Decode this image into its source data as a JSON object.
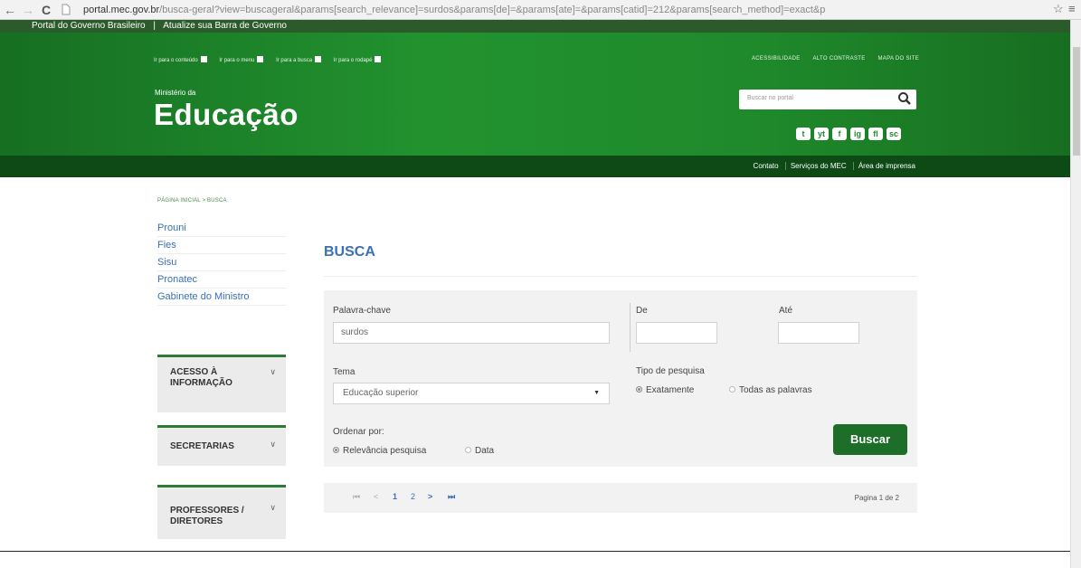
{
  "browser": {
    "back": "←",
    "forward": "→",
    "reload": "C",
    "url_host": "portal.mec.gov.br",
    "url_path": "/busca-geral?view=buscageral&params[search_relevance]=surdos&params[de]=&params[ate]=&params[catid]=212&params[search_method]=exact&p",
    "star": "☆",
    "menu": "≡"
  },
  "govbar": {
    "portal": "Portal do Governo Brasileiro",
    "sep": "|",
    "update": "Atualize sua Barra de Governo"
  },
  "header": {
    "skip_links": [
      "Ir para o conteúdo",
      "Ir para o menu",
      "Ir para a busca",
      "Ir para o rodapé"
    ],
    "tools": [
      "ACESSIBILIDADE",
      "ALTO CONTRASTE",
      "MAPA DO SITE"
    ],
    "ministry": "Ministério da",
    "title": "Educação",
    "search_placeholder": "Buscar no portal",
    "social": [
      "t",
      "yt",
      "f",
      "ig",
      "fl",
      "sc"
    ]
  },
  "subbar": {
    "links": [
      "Contato",
      "Serviços do MEC",
      "Área de imprensa"
    ]
  },
  "breadcrumb": "PÁGINA INICIAL > BUSCA",
  "sidebar": {
    "items": [
      "Prouni",
      "Fies",
      "Sisu",
      "Pronatec",
      "Gabinete do Ministro"
    ],
    "sections": [
      "ACESSO À INFORMAÇÃO",
      "SECRETARIAS",
      "PROFESSORES / DIRETORES"
    ]
  },
  "main": {
    "title": "BUSCA",
    "keyword_label": "Palavra-chave",
    "keyword_value": "surdos",
    "from_label": "De",
    "to_label": "Até",
    "theme_label": "Tema",
    "theme_value": "Educação superior",
    "search_type_label": "Tipo de pesquisa",
    "search_type_options": [
      "Exatamente",
      "Todas as palavras"
    ],
    "order_label": "Ordenar por:",
    "order_options": [
      "Relevância pesquisa",
      "Data"
    ],
    "search_button": "Buscar"
  },
  "pager": {
    "first": "⏮",
    "prev": "<",
    "pages": [
      "1",
      "2"
    ],
    "next": ">",
    "last": "⏭",
    "info": "Pagina 1 de 2"
  }
}
